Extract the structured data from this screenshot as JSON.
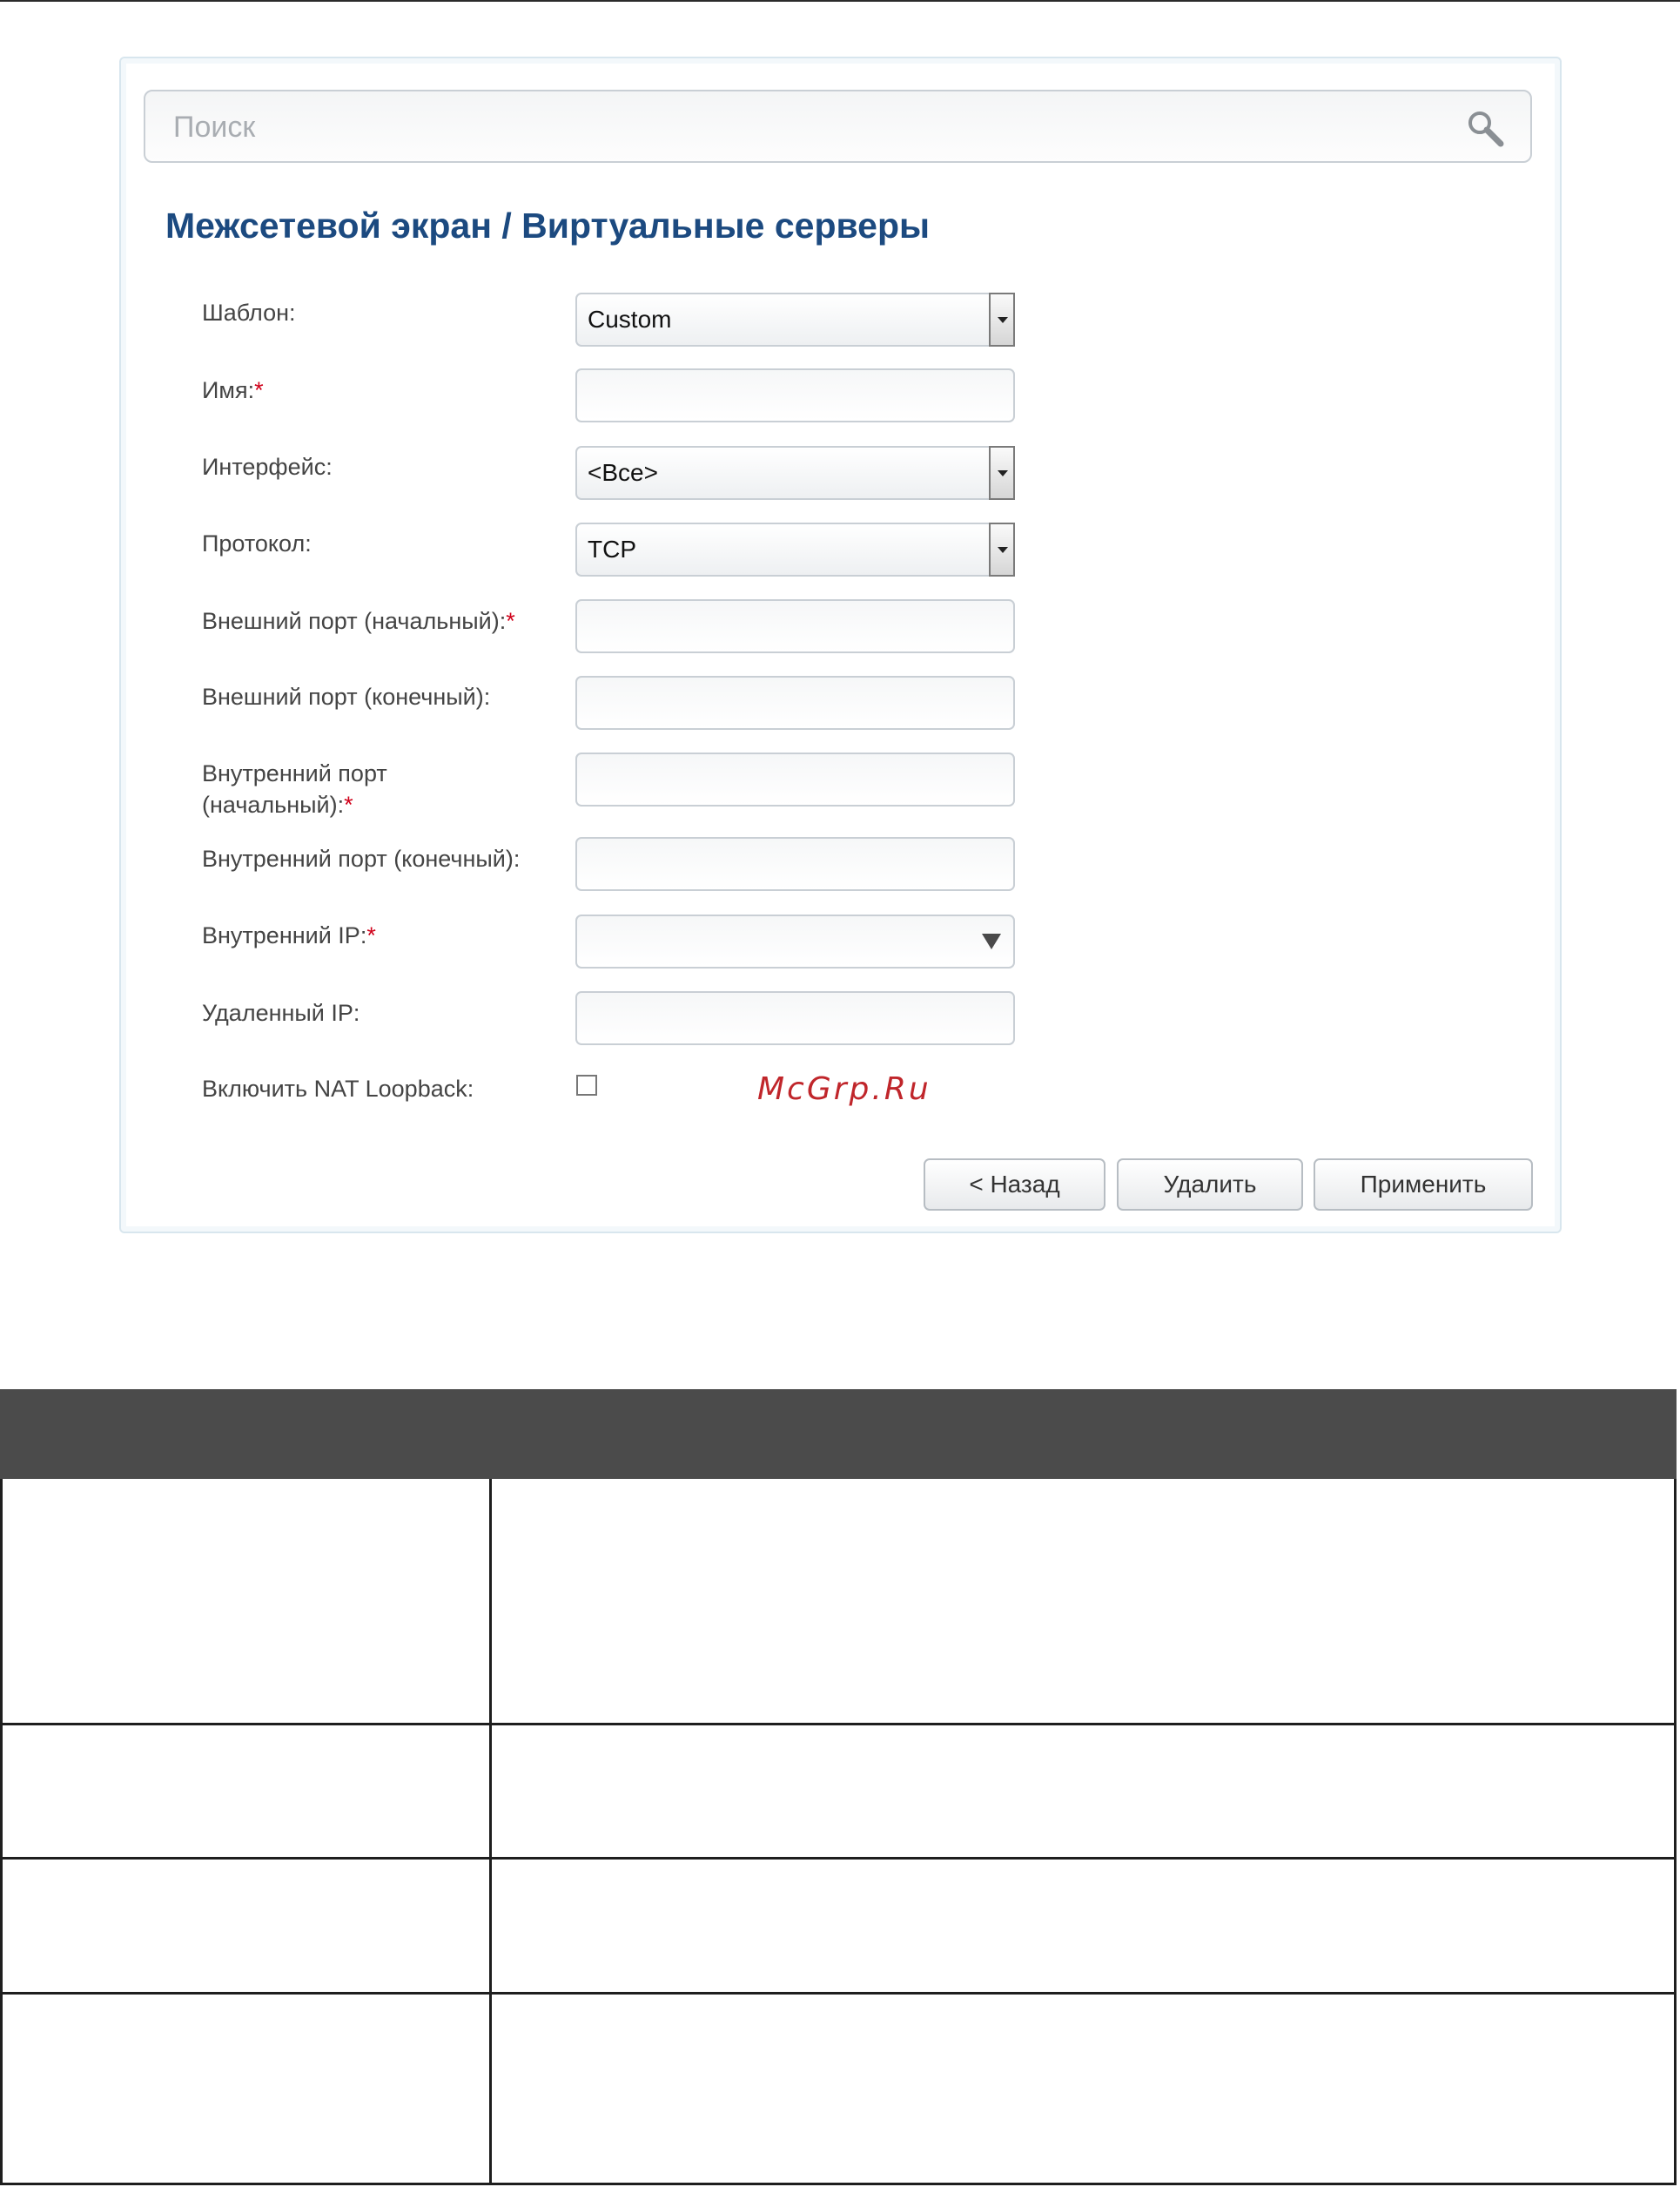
{
  "search": {
    "placeholder": "Поиск"
  },
  "header": {
    "title": "Межсетевой экран /  Виртуальные серверы"
  },
  "form": {
    "template_label": "Шаблон:",
    "template_value": "Custom",
    "name_label": "Имя:",
    "interface_label": "Интерфейс:",
    "interface_value": "<Все>",
    "protocol_label": "Протокол:",
    "protocol_value": "TCP",
    "ext_port_start_label": "Внешний порт (начальный):",
    "ext_port_end_label": "Внешний порт (конечный):",
    "int_port_start_label_line1": "Внутренний порт",
    "int_port_start_label_line2": "(начальный):",
    "int_port_end_label": "Внутренний порт (конечный):",
    "internal_ip_label": "Внутренний IP:",
    "remote_ip_label": "Удаленный IP:",
    "nat_loopback_label": "Включить NAT Loopback:",
    "required_mark": "*"
  },
  "buttons": {
    "back": "< Назад",
    "delete": "Удалить",
    "apply": "Применить"
  },
  "watermark": "McGrp.Ru",
  "colors": {
    "title": "#1c4a80",
    "required": "#d0021b",
    "watermark": "#c0262b",
    "table_header": "#4b4b4b"
  }
}
